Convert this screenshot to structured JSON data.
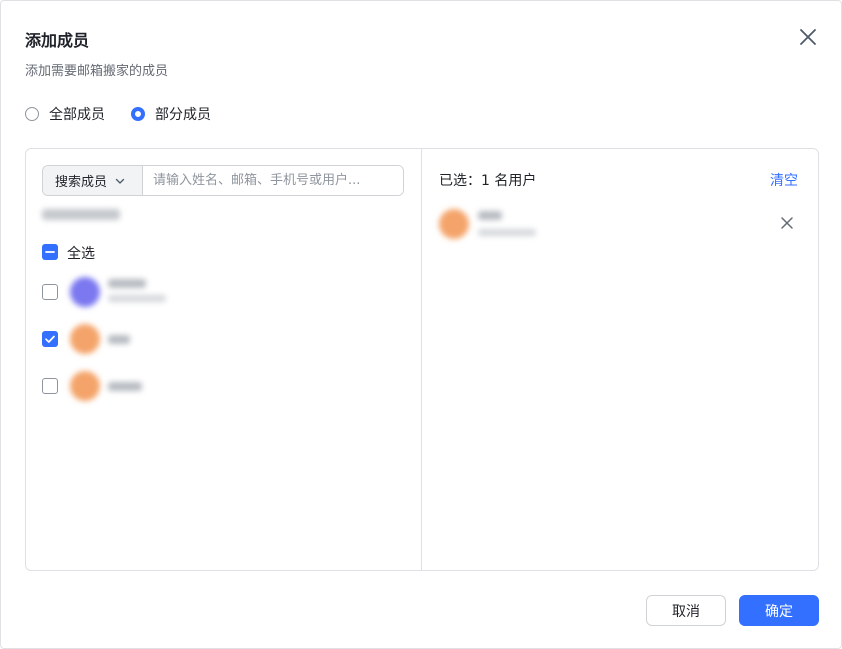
{
  "dialog": {
    "title": "添加成员",
    "subtitle": "添加需要邮箱搬家的成员",
    "close_icon": "close-icon"
  },
  "scope": {
    "options": [
      {
        "label": "全部成员",
        "selected": false
      },
      {
        "label": "部分成员",
        "selected": true
      }
    ]
  },
  "left": {
    "search_type": "搜索成员",
    "search_placeholder": "请输入姓名、邮箱、手机号或用户...",
    "select_all_label": "全选",
    "select_all_state": "indeterminate",
    "members": [
      {
        "checked": false,
        "avatar_color": "#7b78f0"
      },
      {
        "checked": true,
        "avatar_color": "#f4a46a"
      },
      {
        "checked": false,
        "avatar_color": "#f4a46a"
      }
    ]
  },
  "right": {
    "selected_label": "已选：1 名用户",
    "clear_label": "清空",
    "selected": [
      {
        "avatar_color": "#f4a46a"
      }
    ]
  },
  "footer": {
    "cancel_label": "取消",
    "ok_label": "确定"
  },
  "colors": {
    "accent": "#3370ff",
    "border": "#dee0e3"
  }
}
